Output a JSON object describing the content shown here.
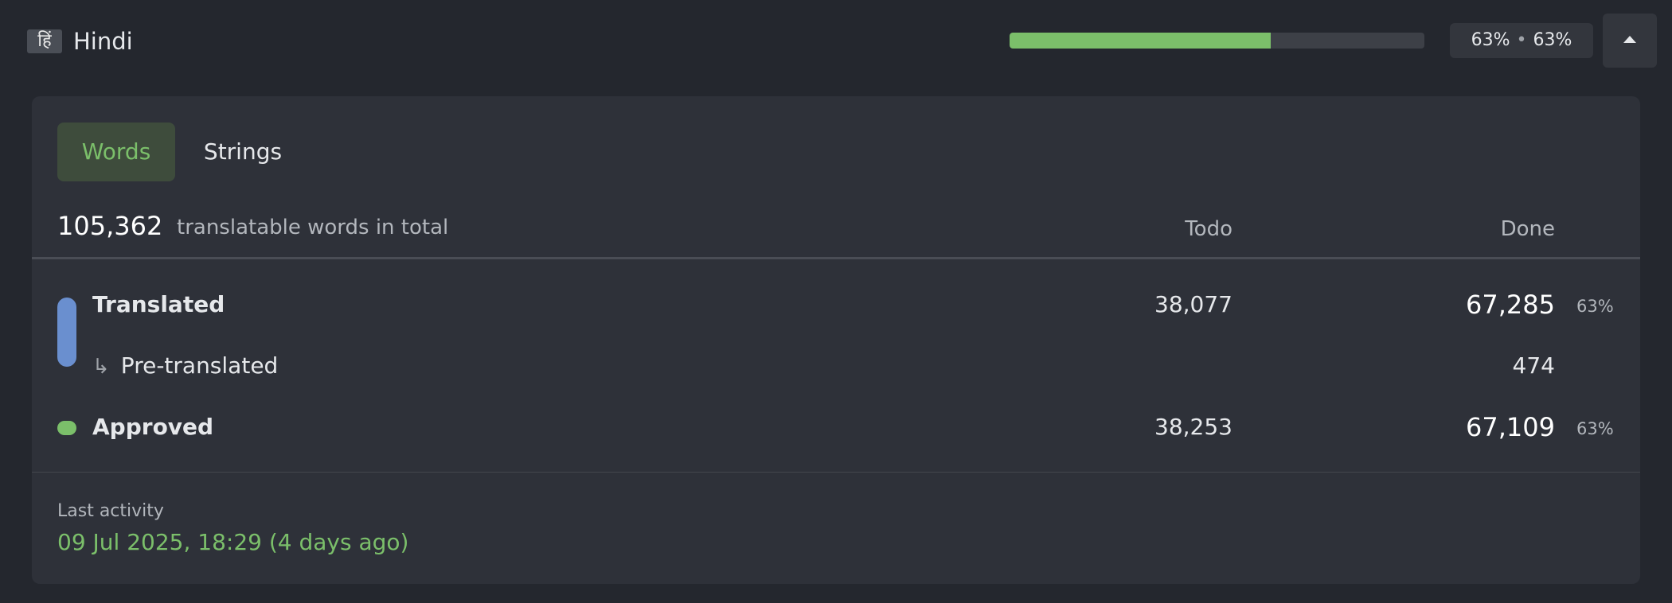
{
  "header": {
    "language_badge": "हिं",
    "language_name": "Hindi",
    "progress_fraction": 0.63,
    "translated_pct": "63%",
    "separator": "•",
    "approved_pct": "63%",
    "accent_color": "#7bbf6a"
  },
  "tabs": [
    {
      "label": "Words",
      "active": true
    },
    {
      "label": "Strings",
      "active": false
    }
  ],
  "summary": {
    "total": "105,362",
    "total_label": "translatable words in total",
    "col_todo": "Todo",
    "col_done": "Done"
  },
  "rows": {
    "translated": {
      "label": "Translated",
      "todo": "38,077",
      "done": "67,285",
      "pct": "63%",
      "color": "#6a8fcf"
    },
    "pretranslated": {
      "arrow": "↳",
      "label": "Pre-translated",
      "done": "474"
    },
    "approved": {
      "label": "Approved",
      "todo": "38,253",
      "done": "67,109",
      "pct": "63%",
      "color": "#7bbf6a"
    }
  },
  "activity": {
    "label": "Last activity",
    "value": "09 Jul 2025, 18:29 (4 days ago)"
  }
}
